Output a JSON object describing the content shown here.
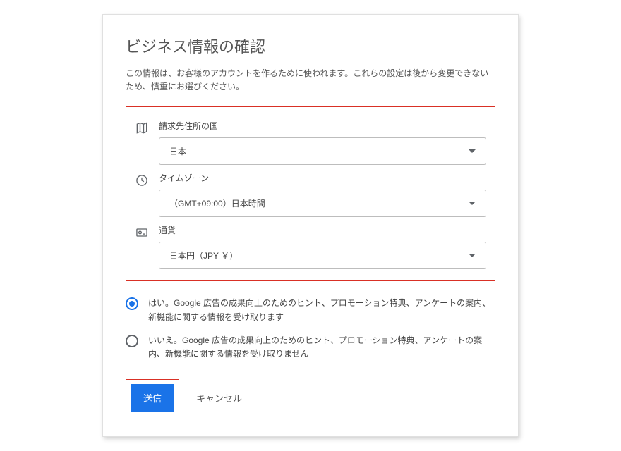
{
  "title": "ビジネス情報の確認",
  "description": "この情報は、お客様のアカウントを作るために使われます。これらの設定は後から変更できないため、慎重にお選びください。",
  "fields": {
    "country": {
      "label": "請求先住所の国",
      "value": "日本"
    },
    "timezone": {
      "label": "タイムゾーン",
      "value": "（GMT+09:00）日本時間"
    },
    "currency": {
      "label": "通貨",
      "value": "日本円（JPY ￥）"
    }
  },
  "radios": {
    "yes": "はい。Google 広告の成果向上のためのヒント、プロモーション特典、アンケートの案内、新機能に関する情報を受け取ります",
    "no": "いいえ。Google 広告の成果向上のためのヒント、プロモーション特典、アンケートの案内、新機能に関する情報を受け取りません"
  },
  "buttons": {
    "submit": "送信",
    "cancel": "キャンセル"
  }
}
